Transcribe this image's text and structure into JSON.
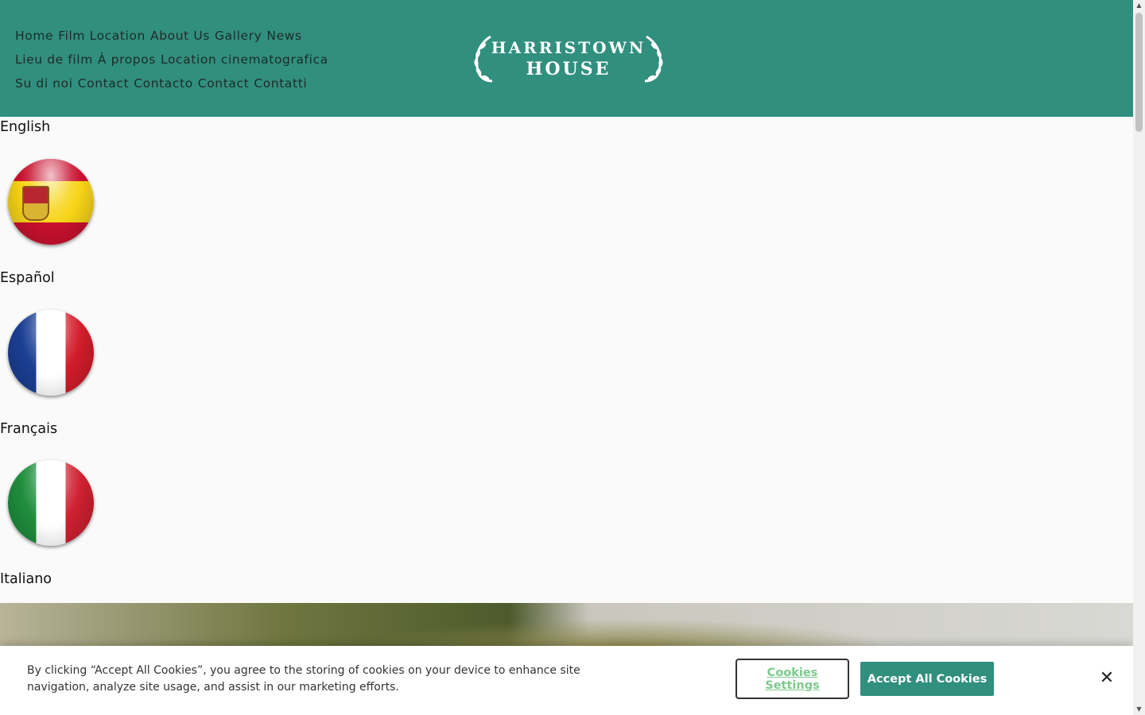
{
  "brand": {
    "logo_line1": "HARRISTOWN",
    "logo_line2": "HOUSE"
  },
  "nav": {
    "row1": [
      "Home",
      "Film Location",
      "About Us",
      "Gallery",
      "News"
    ],
    "row2": [
      "Lieu de film",
      "À propos",
      "Location cinematografica"
    ],
    "row3": [
      "Su di noi",
      "Contact",
      "Contacto",
      "Contact",
      "Contatti"
    ]
  },
  "languages": [
    {
      "label": "English"
    },
    {
      "label": "Español",
      "flag": "spain-flag-icon"
    },
    {
      "label": "Français",
      "flag": "france-flag-icon"
    },
    {
      "label": "Italiano",
      "flag": "italy-flag-icon"
    }
  ],
  "cookie_banner": {
    "text": "By clicking “Accept All Cookies”, you agree to the storing of cookies on your device to enhance site navigation, analyze site usage, and assist in our marketing efforts.",
    "settings_label": "Cookies Settings",
    "accept_label": "Accept All Cookies",
    "close_icon": "✕"
  },
  "colors": {
    "header_bg": "#318f7e",
    "accept_bg": "#318f7e",
    "settings_text": "#7cc98b"
  }
}
